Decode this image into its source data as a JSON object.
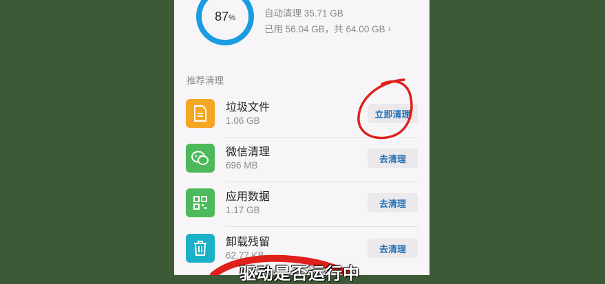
{
  "storage": {
    "percent": "87",
    "percent_sign": "%",
    "auto_clean": "自动清理 35.71 GB",
    "usage": "已用 56.04 GB，共 64.00 GB"
  },
  "section_title": "推荐清理",
  "items": [
    {
      "title": "垃圾文件",
      "size": "1.06 GB",
      "button": "立即清理",
      "icon": "file-icon",
      "color": "#f5a623"
    },
    {
      "title": "微信清理",
      "size": "696 MB",
      "button": "去清理",
      "icon": "wechat-icon",
      "color": "#4cba5a"
    },
    {
      "title": "应用数据",
      "size": "1.17 GB",
      "button": "去清理",
      "icon": "apps-grid-icon",
      "color": "#4cba5a"
    },
    {
      "title": "卸载残留",
      "size": "62.77 KB",
      "button": "去清理",
      "icon": "trash-icon",
      "color": "#19b0c8"
    }
  ],
  "subtitle": "驱动是否运行中",
  "colors": {
    "ring": "#1a9ce0",
    "button_text": "#1f6fb5",
    "annotation": "#e0201a"
  }
}
